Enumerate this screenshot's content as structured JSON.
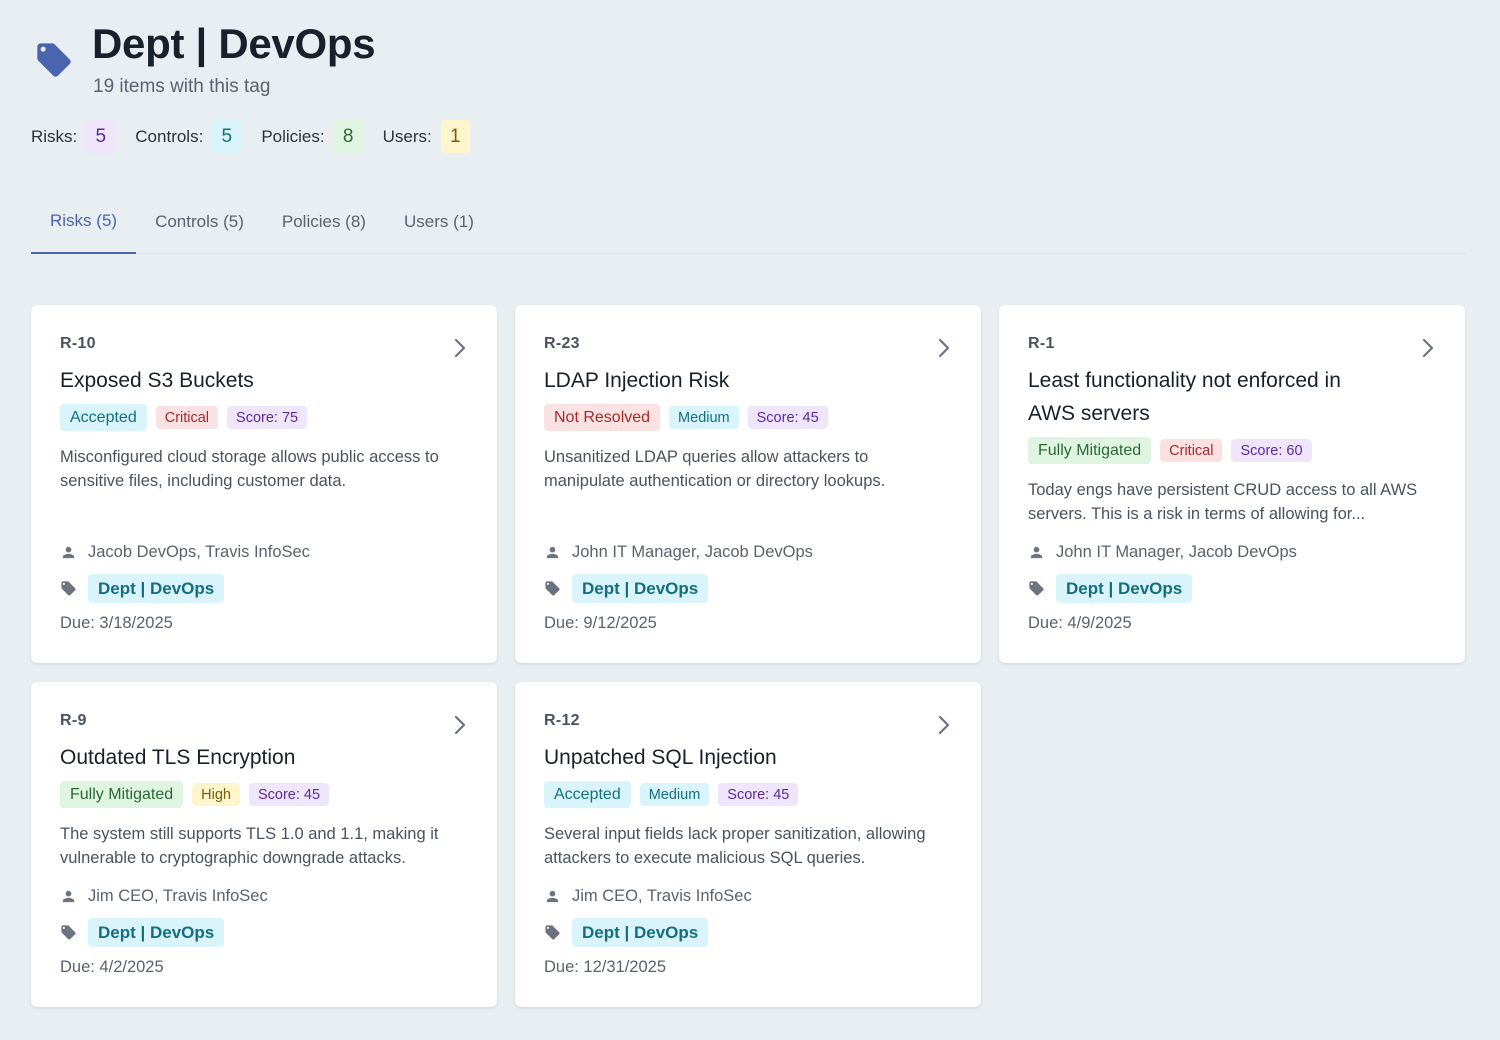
{
  "header": {
    "title": "Dept | DevOps",
    "subtitle": "19 items with this tag"
  },
  "counts": [
    {
      "label": "Risks:",
      "value": "5"
    },
    {
      "label": "Controls:",
      "value": "5"
    },
    {
      "label": "Policies:",
      "value": "8"
    },
    {
      "label": "Users:",
      "value": "1"
    }
  ],
  "tabs": [
    {
      "label": "Risks (5)",
      "active": true
    },
    {
      "label": "Controls (5)",
      "active": false
    },
    {
      "label": "Policies (8)",
      "active": false
    },
    {
      "label": "Users (1)",
      "active": false
    }
  ],
  "cards": [
    {
      "id": "R-10",
      "title": "Exposed S3 Buckets",
      "status": "Accepted",
      "severity": "Critical",
      "score": "Score: 75",
      "description": "Misconfigured cloud storage allows public access to sensitive files, including customer data.",
      "owners": "Jacob DevOps, Travis InfoSec",
      "tag": "Dept | DevOps",
      "due": "Due: 3/18/2025"
    },
    {
      "id": "R-23",
      "title": "LDAP Injection Risk",
      "status": "Not Resolved",
      "severity": "Medium",
      "score": "Score: 45",
      "description": "Unsanitized LDAP queries allow attackers to manipulate authentication or directory lookups.",
      "owners": "John IT Manager, Jacob DevOps",
      "tag": "Dept | DevOps",
      "due": "Due: 9/12/2025"
    },
    {
      "id": "R-1",
      "title": "Least functionality not enforced in AWS servers",
      "status": "Fully Mitigated",
      "severity": "Critical",
      "score": "Score: 60",
      "description": "Today engs have persistent CRUD access to all AWS servers. This is a risk in terms of allowing for...",
      "owners": "John IT Manager, Jacob DevOps",
      "tag": "Dept | DevOps",
      "due": "Due: 4/9/2025"
    },
    {
      "id": "R-9",
      "title": "Outdated TLS Encryption",
      "status": "Fully Mitigated",
      "severity": "High",
      "score": "Score: 45",
      "description": "The system still supports TLS 1.0 and 1.1, making it vulnerable to cryptographic downgrade attacks.",
      "owners": "Jim CEO, Travis InfoSec",
      "tag": "Dept | DevOps",
      "due": "Due: 4/2/2025"
    },
    {
      "id": "R-12",
      "title": "Unpatched SQL Injection",
      "status": "Accepted",
      "severity": "Medium",
      "score": "Score: 45",
      "description": "Several input fields lack proper sanitization, allowing attackers to execute malicious SQL queries.",
      "owners": "Jim CEO, Travis InfoSec",
      "tag": "Dept | DevOps",
      "due": "Due: 12/31/2025"
    }
  ],
  "colors": {
    "accent": "#4a64b0",
    "background": "#e8eef1",
    "tag_icon": "#4a64b0"
  }
}
